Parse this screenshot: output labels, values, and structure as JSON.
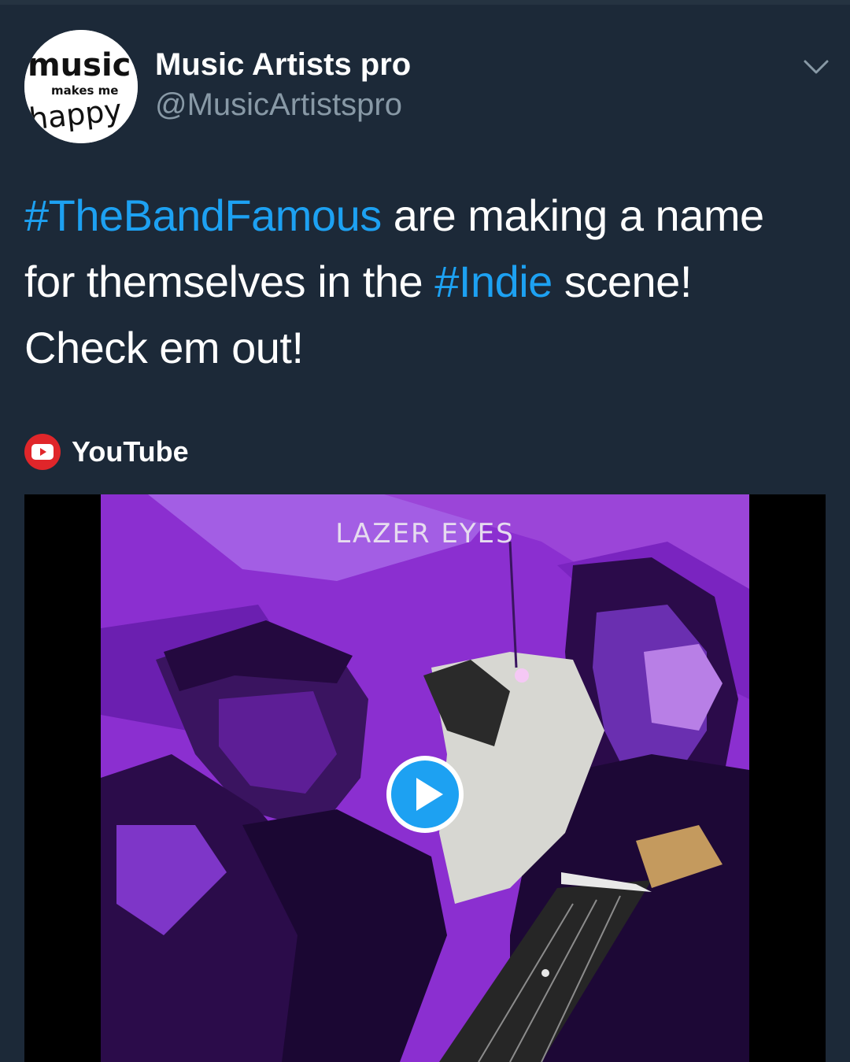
{
  "tweet": {
    "author": {
      "display_name": "Music Artists pro",
      "handle": "@MusicArtistspro",
      "avatar_text": [
        "music",
        "makes me",
        "happy"
      ]
    },
    "text_lines": [
      [
        {
          "text": "#TheBandFamous",
          "hashtag": true
        },
        {
          "text": " are making a name",
          "hashtag": false
        }
      ],
      [
        {
          "text": "for themselves in the ",
          "hashtag": false
        },
        {
          "text": "#Indie",
          "hashtag": true
        },
        {
          "text": " scene!",
          "hashtag": false
        }
      ],
      [
        {
          "text": "Check em out!",
          "hashtag": false
        }
      ]
    ],
    "card": {
      "source": "YouTube",
      "video_title": "LAZER EYES"
    }
  },
  "icons": {
    "chevron": "chevron-down-icon",
    "source": "youtube-icon",
    "play": "play-icon"
  },
  "colors": {
    "background": "#1c2938",
    "hashtag": "#1da1f2",
    "secondary_text": "#8899a6",
    "youtube_red": "#e0262a",
    "art_purple": "#8b2fd0"
  }
}
